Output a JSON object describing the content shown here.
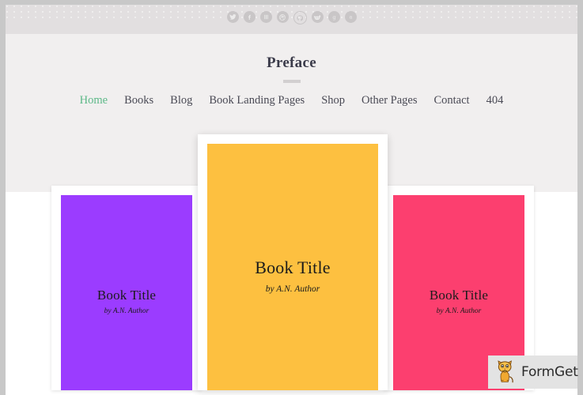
{
  "site": {
    "title": "Preface"
  },
  "social": {
    "items": [
      {
        "name": "twitter-icon",
        "label": "Twitter",
        "glyph": "bird"
      },
      {
        "name": "facebook-icon",
        "label": "Facebook",
        "glyph": "f"
      },
      {
        "name": "instapaper-icon",
        "label": "Instapaper",
        "glyph": "ili"
      },
      {
        "name": "dribbble-icon",
        "label": "Dribbble",
        "glyph": "ball"
      },
      {
        "name": "github-icon",
        "label": "GitHub",
        "glyph": "cat"
      },
      {
        "name": "reddit-icon",
        "label": "Reddit",
        "glyph": "alien"
      },
      {
        "name": "goodreads-icon",
        "label": "Goodreads",
        "glyph": "g"
      },
      {
        "name": "amazon-icon",
        "label": "Amazon",
        "glyph": "a"
      }
    ]
  },
  "nav": {
    "items": [
      {
        "label": "Home",
        "active": true
      },
      {
        "label": "Books",
        "active": false
      },
      {
        "label": "Blog",
        "active": false
      },
      {
        "label": "Book Landing Pages",
        "active": false
      },
      {
        "label": "Shop",
        "active": false
      },
      {
        "label": "Other Pages",
        "active": false
      },
      {
        "label": "Contact",
        "active": false
      },
      {
        "label": "404",
        "active": false
      }
    ]
  },
  "books": [
    {
      "position": "left",
      "title": "Book Title",
      "author": "by A.N. Author",
      "color": "#9b3cff"
    },
    {
      "position": "center",
      "title": "Book Title",
      "author": "by A.N. Author",
      "color": "#fdc040"
    },
    {
      "position": "right",
      "title": "Book Title",
      "author": "by A.N. Author",
      "color": "#fc3f6f"
    }
  ],
  "colors": {
    "header_background": "#f1efef",
    "social_background": "#e2dfe0",
    "accent_green": "#5cb887",
    "title_text": "#3b3b4a",
    "nav_text": "#4a4a55",
    "frame_gray": "#c8c8c8"
  },
  "watermark": {
    "text": "FormGet"
  }
}
